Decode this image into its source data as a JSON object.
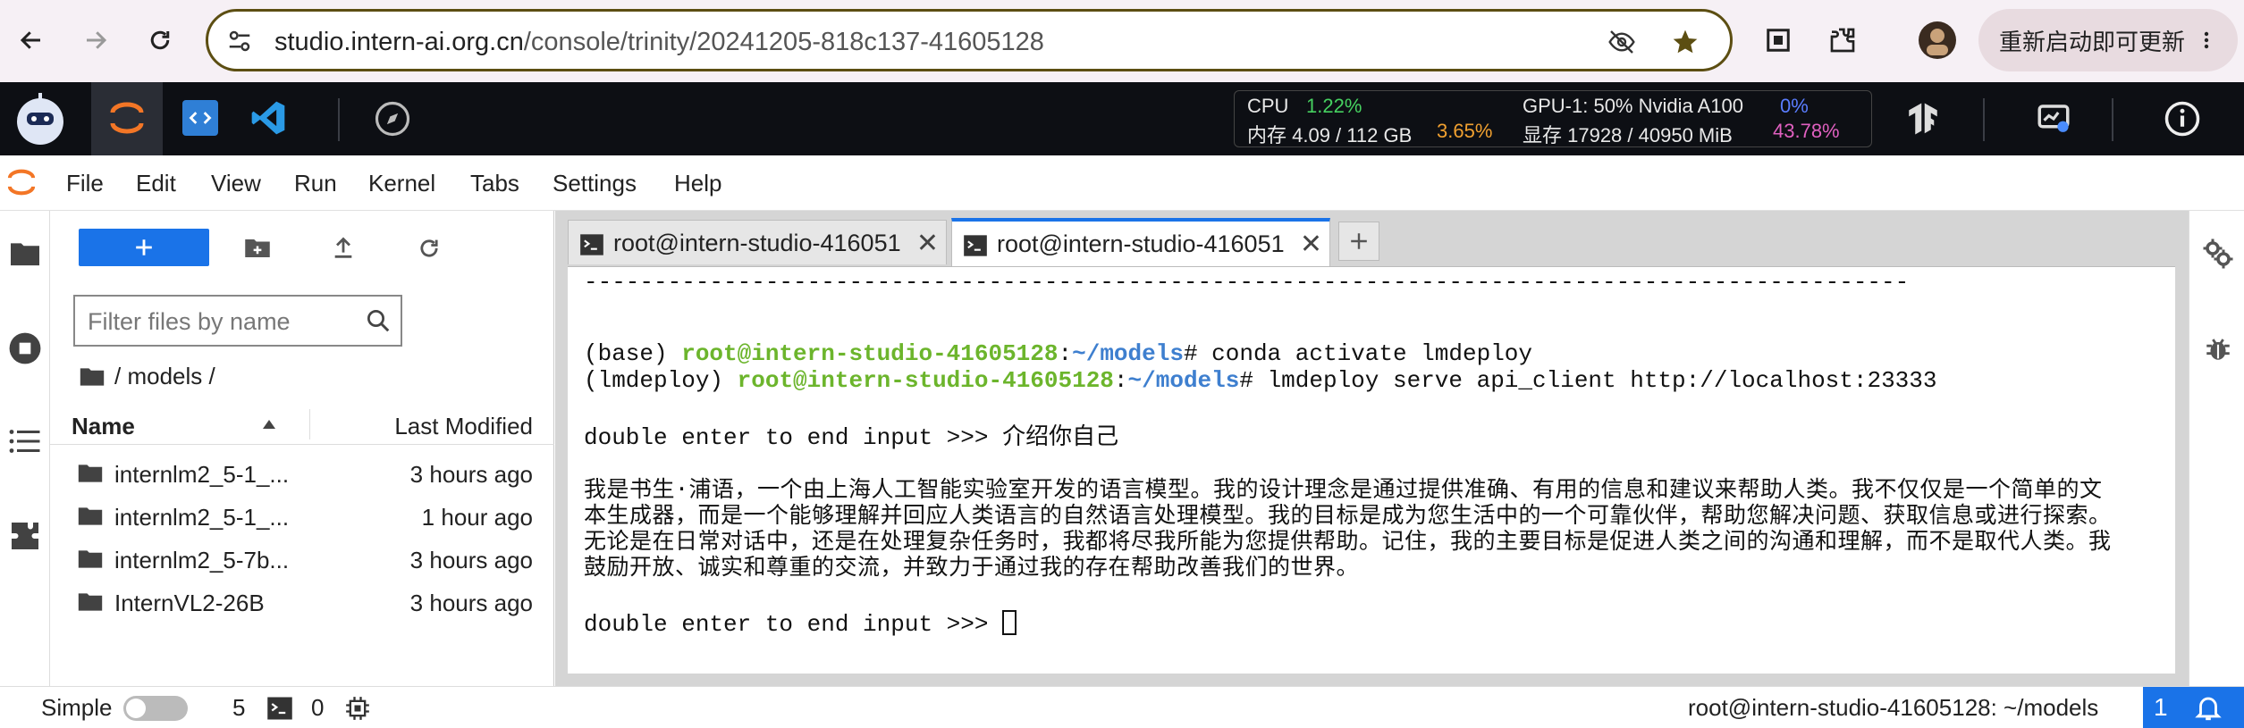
{
  "browser": {
    "url_host": "studio.intern-ai.org.cn",
    "url_path": "/console/trinity/20241205-818c137-41605128",
    "update_label": "重新启动即可更新"
  },
  "stats": {
    "cpu_label": "CPU",
    "cpu_value": "1.22%",
    "mem_label": "内存 4.09 / 112 GB",
    "mem_value": "3.65%",
    "gpu_label": "GPU-1: 50% Nvidia A100",
    "gpu_value": "0%",
    "vram_label": "显存 17928 / 40950 MiB",
    "vram_value": "43.78%"
  },
  "menu": [
    "File",
    "Edit",
    "View",
    "Run",
    "Kernel",
    "Tabs",
    "Settings",
    "Help"
  ],
  "filebrowser": {
    "filter_placeholder": "Filter files by name",
    "breadcrumb": "/ models /",
    "col_name": "Name",
    "col_modified": "Last Modified",
    "files": [
      {
        "name": "internlm2_5-1_...",
        "modified": "3 hours ago"
      },
      {
        "name": "internlm2_5-1_...",
        "modified": "1 hour ago"
      },
      {
        "name": "internlm2_5-7b...",
        "modified": "3 hours ago"
      },
      {
        "name": "InternVL2-26B",
        "modified": "3 hours ago"
      }
    ]
  },
  "tabs": [
    {
      "label": "root@intern-studio-416051"
    },
    {
      "label": "root@intern-studio-416051"
    }
  ],
  "terminal": {
    "rule": "-----------------------------------------------------------------------------------------------",
    "line1_env": "(base) ",
    "line1_user": "root@intern-studio-41605128",
    "line1_colon": ":",
    "line1_path": "~/models",
    "line1_cmd": "# conda activate lmdeploy",
    "line2_env": "(lmdeploy) ",
    "line2_user": "root@intern-studio-41605128",
    "line2_colon": ":",
    "line2_path": "~/models",
    "line2_cmd": "# lmdeploy serve api_client http://localhost:23333",
    "prompt1": "double enter to end input >>> 介绍你自己",
    "response": "我是书生·浦语，一个由上海人工智能实验室开发的语言模型。我的设计理念是通过提供准确、有用的信息和建议来帮助人类。我不仅仅是一个简单的文本生成器，而是一个能够理解并回应人类语言的自然语言处理模型。我的目标是成为您生活中的一个可靠伙伴，帮助您解决问题、获取信息或进行探索。无论是在日常对话中，还是在处理复杂任务时，我都将尽我所能为您提供帮助。记住，我的主要目标是促进人类之间的沟通和理解，而不是取代人类。我鼓励开放、诚实和尊重的交流，并致力于通过我的存在帮助改善我们的世界。",
    "prompt2": "double enter to end input >>> "
  },
  "status": {
    "mode_label": "Simple",
    "kernels_count": "5",
    "terminals_count": "0",
    "context": "root@intern-studio-41605128: ~/models",
    "notifications": "1"
  }
}
